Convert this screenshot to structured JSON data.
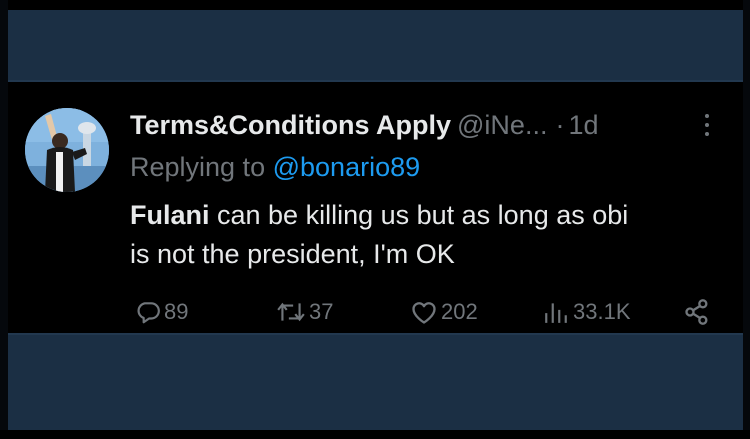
{
  "tweet": {
    "display_name": "Terms&Conditions Apply",
    "handle": "@iNe...",
    "separator": "·",
    "time": "1d",
    "replying_prefix": "Replying to",
    "replying_to": "@bonario89",
    "body_bold": "Fulani",
    "body_line1_rest": " can be killing us but as long as obi",
    "body_line2": "is not the president, I'm OK"
  },
  "actions": {
    "replies": "89",
    "reposts": "37",
    "likes": "202",
    "views": "33.1K"
  },
  "icons": {
    "reply": "reply-icon",
    "repost": "repost-icon",
    "like": "heart-icon",
    "views": "views-icon",
    "share": "share-icon",
    "more": "more-options-icon"
  },
  "colors": {
    "background": "#000000",
    "outer": "#1b2f44",
    "text": "#e7e9ea",
    "muted": "#71767b",
    "link": "#1d9bf0"
  }
}
